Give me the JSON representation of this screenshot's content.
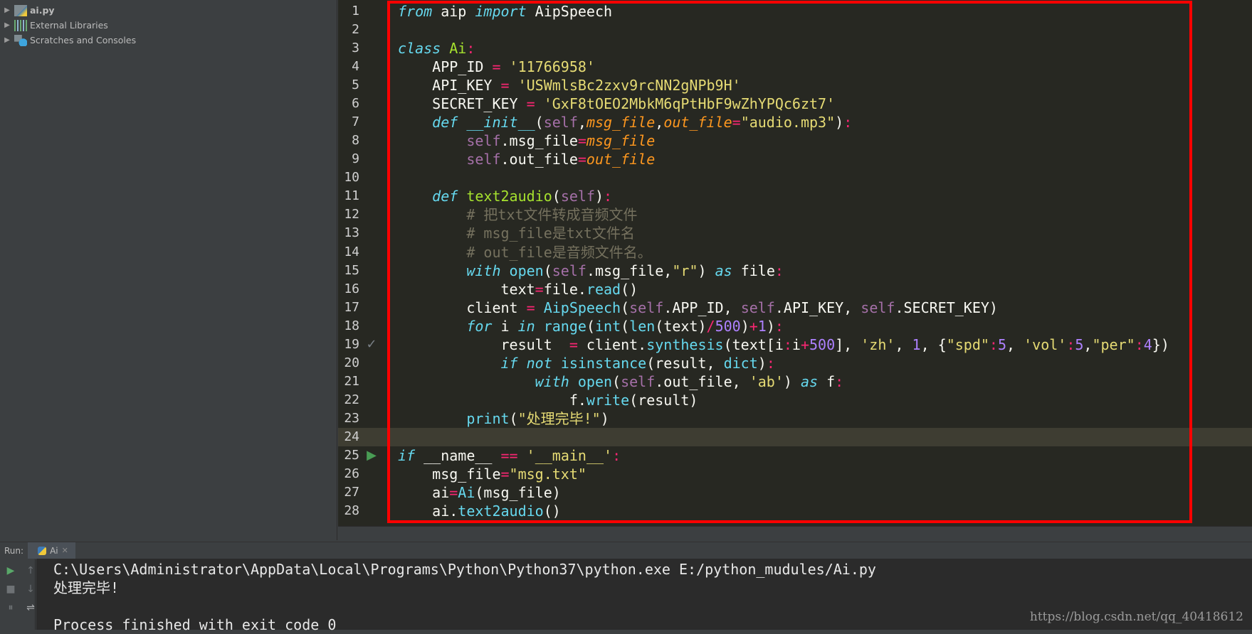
{
  "project_tree": [
    {
      "label": "ai.py",
      "icon": "python-file-icon",
      "bold": true
    },
    {
      "label": "External Libraries",
      "icon": "libraries-icon",
      "bold": false
    },
    {
      "label": "Scratches and Consoles",
      "icon": "scratches-icon",
      "bold": false
    }
  ],
  "editor": {
    "current_line": 24,
    "line_markers": {
      "19": "check-icon",
      "25": "run-gutter-icon"
    },
    "lines": [
      [
        [
          "k",
          "from"
        ],
        [
          "d",
          " aip "
        ],
        [
          "k",
          "import"
        ],
        [
          "d",
          " AipSpeech"
        ]
      ],
      [],
      [
        [
          "k",
          "class"
        ],
        [
          "d",
          " "
        ],
        [
          "g",
          "Ai"
        ],
        [
          "o",
          ":"
        ]
      ],
      [
        [
          "d",
          "    APP_ID "
        ],
        [
          "o",
          "="
        ],
        [
          "d",
          " "
        ],
        [
          "s",
          "'11766958'"
        ]
      ],
      [
        [
          "d",
          "    API_KEY "
        ],
        [
          "o",
          "="
        ],
        [
          "d",
          " "
        ],
        [
          "s",
          "'USWmlsBc2zxv9rcNN2gNPb9H'"
        ]
      ],
      [
        [
          "d",
          "    SECRET_KEY "
        ],
        [
          "o",
          "="
        ],
        [
          "d",
          " "
        ],
        [
          "s",
          "'GxF8tOEO2MbkM6qPtHbF9wZhYPQc6zt7'"
        ]
      ],
      [
        [
          "d",
          "    "
        ],
        [
          "k",
          "def"
        ],
        [
          "d",
          " "
        ],
        [
          "k",
          "__init__"
        ],
        [
          "d",
          "("
        ],
        [
          "f",
          "self"
        ],
        [
          "d",
          ","
        ],
        [
          "p",
          "msg_file"
        ],
        [
          "d",
          ","
        ],
        [
          "p",
          "out_file"
        ],
        [
          "o",
          "="
        ],
        [
          "s",
          "\"audio.mp3\""
        ],
        [
          "d",
          ")"
        ],
        [
          "o",
          ":"
        ]
      ],
      [
        [
          "d",
          "        "
        ],
        [
          "f",
          "self"
        ],
        [
          "d",
          ".msg_file"
        ],
        [
          "o",
          "="
        ],
        [
          "p",
          "msg_file"
        ]
      ],
      [
        [
          "d",
          "        "
        ],
        [
          "f",
          "self"
        ],
        [
          "d",
          ".out_file"
        ],
        [
          "o",
          "="
        ],
        [
          "p",
          "out_file"
        ]
      ],
      [],
      [
        [
          "d",
          "    "
        ],
        [
          "k",
          "def"
        ],
        [
          "d",
          " "
        ],
        [
          "g",
          "text2audio"
        ],
        [
          "d",
          "("
        ],
        [
          "f",
          "self"
        ],
        [
          "d",
          ")"
        ],
        [
          "o",
          ":"
        ]
      ],
      [
        [
          "c",
          "        # 把txt文件转成音频文件"
        ]
      ],
      [
        [
          "c",
          "        # msg_file是txt文件名"
        ]
      ],
      [
        [
          "c",
          "        # out_file是音频文件名。"
        ]
      ],
      [
        [
          "d",
          "        "
        ],
        [
          "k",
          "with"
        ],
        [
          "d",
          " "
        ],
        [
          "b",
          "open"
        ],
        [
          "d",
          "("
        ],
        [
          "f",
          "self"
        ],
        [
          "d",
          ".msg_file,"
        ],
        [
          "s",
          "\"r\""
        ],
        [
          "d",
          ") "
        ],
        [
          "k",
          "as"
        ],
        [
          "d",
          " file"
        ],
        [
          "o",
          ":"
        ]
      ],
      [
        [
          "d",
          "            text"
        ],
        [
          "o",
          "="
        ],
        [
          "d",
          "file."
        ],
        [
          "b",
          "read"
        ],
        [
          "d",
          "()"
        ]
      ],
      [
        [
          "d",
          "        client "
        ],
        [
          "o",
          "="
        ],
        [
          "d",
          " "
        ],
        [
          "b",
          "AipSpeech"
        ],
        [
          "d",
          "("
        ],
        [
          "f",
          "self"
        ],
        [
          "d",
          ".APP_ID, "
        ],
        [
          "f",
          "self"
        ],
        [
          "d",
          ".API_KEY, "
        ],
        [
          "f",
          "self"
        ],
        [
          "d",
          ".SECRET_KEY)"
        ]
      ],
      [
        [
          "d",
          "        "
        ],
        [
          "k",
          "for"
        ],
        [
          "d",
          " i "
        ],
        [
          "k",
          "in"
        ],
        [
          "d",
          " "
        ],
        [
          "b",
          "range"
        ],
        [
          "d",
          "("
        ],
        [
          "b",
          "int"
        ],
        [
          "d",
          "("
        ],
        [
          "b",
          "len"
        ],
        [
          "d",
          "(text)"
        ],
        [
          "o",
          "/"
        ],
        [
          "n",
          "500"
        ],
        [
          "d",
          ")"
        ],
        [
          "o",
          "+"
        ],
        [
          "n",
          "1"
        ],
        [
          "d",
          ")"
        ],
        [
          "o",
          ":"
        ]
      ],
      [
        [
          "d",
          "            result  "
        ],
        [
          "o",
          "="
        ],
        [
          "d",
          " client."
        ],
        [
          "b",
          "synthesis"
        ],
        [
          "d",
          "(text[i"
        ],
        [
          "o",
          ":"
        ],
        [
          "d",
          "i"
        ],
        [
          "o",
          "+"
        ],
        [
          "n",
          "500"
        ],
        [
          "d",
          "], "
        ],
        [
          "s",
          "'zh'"
        ],
        [
          "d",
          ", "
        ],
        [
          "n",
          "1"
        ],
        [
          "d",
          ", {"
        ],
        [
          "s",
          "\"spd\""
        ],
        [
          "o",
          ":"
        ],
        [
          "n",
          "5"
        ],
        [
          "d",
          ", "
        ],
        [
          "s",
          "'vol'"
        ],
        [
          "o",
          ":"
        ],
        [
          "n",
          "5"
        ],
        [
          "d",
          ","
        ],
        [
          "s",
          "\"per\""
        ],
        [
          "o",
          ":"
        ],
        [
          "n",
          "4"
        ],
        [
          "d",
          "})"
        ]
      ],
      [
        [
          "d",
          "            "
        ],
        [
          "k",
          "if not"
        ],
        [
          "d",
          " "
        ],
        [
          "b",
          "isinstance"
        ],
        [
          "d",
          "(result, "
        ],
        [
          "b",
          "dict"
        ],
        [
          "d",
          ")"
        ],
        [
          "o",
          ":"
        ]
      ],
      [
        [
          "d",
          "                "
        ],
        [
          "k",
          "with"
        ],
        [
          "d",
          " "
        ],
        [
          "b",
          "open"
        ],
        [
          "d",
          "("
        ],
        [
          "f",
          "self"
        ],
        [
          "d",
          ".out_file, "
        ],
        [
          "s",
          "'ab'"
        ],
        [
          "d",
          ") "
        ],
        [
          "k",
          "as"
        ],
        [
          "d",
          " f"
        ],
        [
          "o",
          ":"
        ]
      ],
      [
        [
          "d",
          "                    f."
        ],
        [
          "b",
          "write"
        ],
        [
          "d",
          "(result)"
        ]
      ],
      [
        [
          "d",
          "        "
        ],
        [
          "b",
          "print"
        ],
        [
          "d",
          "("
        ],
        [
          "s",
          "\"处理完毕!\""
        ],
        [
          "d",
          ")"
        ]
      ],
      [],
      [
        [
          "k",
          "if"
        ],
        [
          "d",
          " __name__ "
        ],
        [
          "o",
          "=="
        ],
        [
          "d",
          " "
        ],
        [
          "s",
          "'__main__'"
        ],
        [
          "o",
          ":"
        ]
      ],
      [
        [
          "d",
          "    msg_file"
        ],
        [
          "o",
          "="
        ],
        [
          "s",
          "\"msg.txt\""
        ]
      ],
      [
        [
          "d",
          "    ai"
        ],
        [
          "o",
          "="
        ],
        [
          "b",
          "Ai"
        ],
        [
          "d",
          "(msg_file)"
        ]
      ],
      [
        [
          "d",
          "    ai."
        ],
        [
          "b",
          "text2audio"
        ],
        [
          "d",
          "()"
        ]
      ]
    ]
  },
  "run_panel": {
    "label": "Run:",
    "tab": "Ai",
    "console": [
      "C:\\Users\\Administrator\\AppData\\Local\\Programs\\Python\\Python37\\python.exe E:/python_mudules/Ai.py",
      "处理完毕!",
      "",
      "Process finished with exit code 0"
    ]
  },
  "watermark": "https://blog.csdn.net/qq_40418612",
  "colors": {
    "highlight_box": "#ff0000",
    "editor_bg": "#272822"
  }
}
